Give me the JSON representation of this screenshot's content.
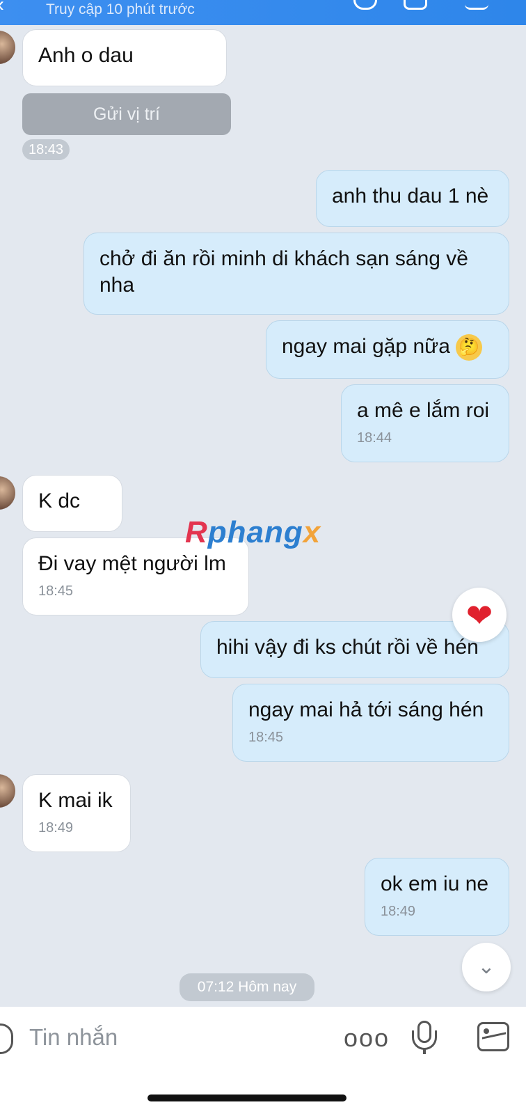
{
  "header": {
    "status": "Truy cập 10 phút trước",
    "icons": [
      "back-icon",
      "phone-icon",
      "video-icon",
      "menu-icon"
    ]
  },
  "messages": {
    "m1": "Anh o dau",
    "location_button": "Gửi vị trí",
    "t1843": "18:43",
    "m2": "anh thu dau 1 nè",
    "m3": "chở đi ăn rồi minh di khách sạn sáng về nha",
    "m4": "ngay mai gặp nữa",
    "m4_emoji": "🤔",
    "m5": "a mê e lắm roi",
    "m5_time": "18:44",
    "m6": "K dc",
    "m7": "Đi vay mệt người lm",
    "m7_time": "18:45",
    "reaction": "❤",
    "m8": "hihi vậy đi ks chút rồi về hén",
    "m9": "ngay mai hả tới sáng hén",
    "m9_time": "18:45",
    "m10": "K mai ik",
    "m10_time": "18:49",
    "m11": "ok em iu ne",
    "m11_time": "18:49",
    "divider": "07:12 Hôm nay"
  },
  "watermark": {
    "part1": "R",
    "part2": "phang",
    "part3": "x"
  },
  "input": {
    "placeholder": "Tin nhắn",
    "more": "ooo"
  },
  "colors": {
    "header": "#2e86ea",
    "outgoing_bubble": "#d6ecfb",
    "incoming_bubble": "#ffffff",
    "background": "#e3e8ef"
  }
}
